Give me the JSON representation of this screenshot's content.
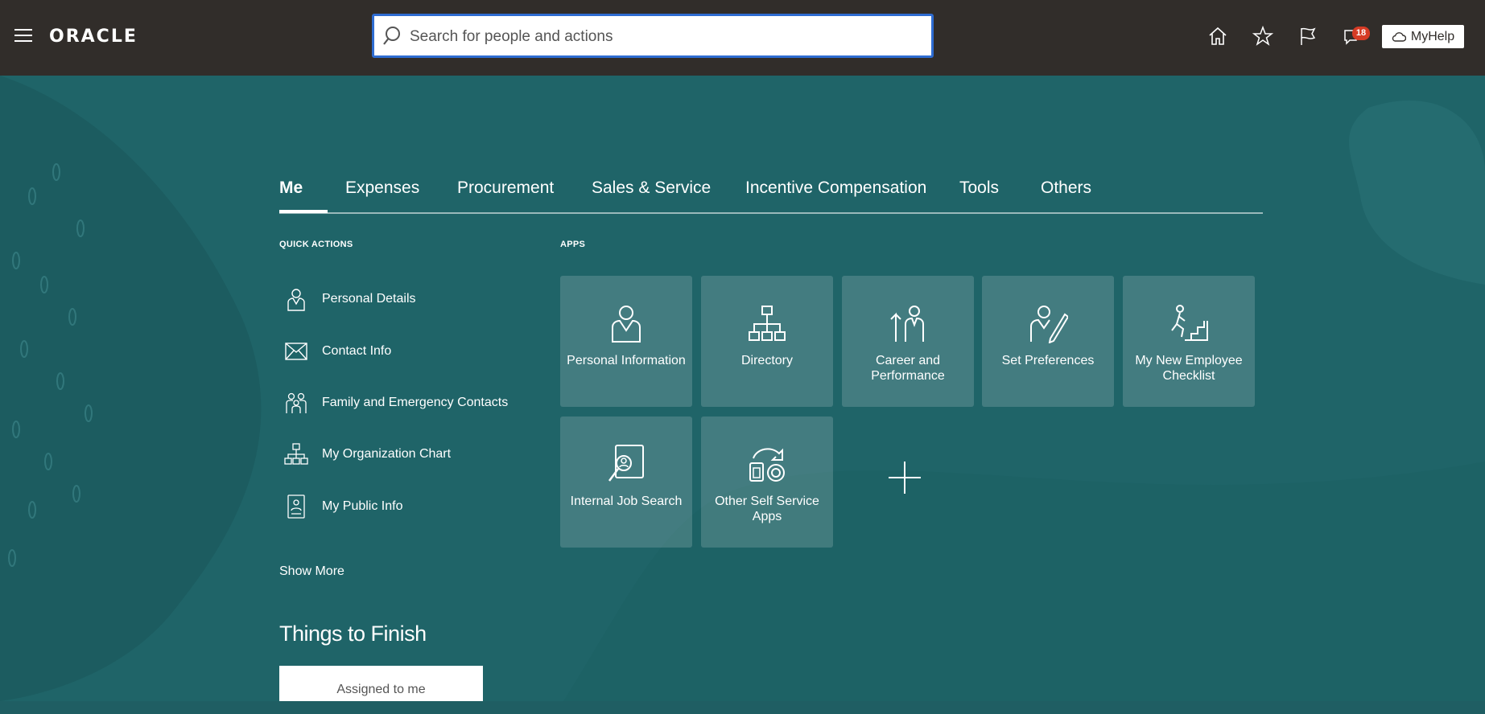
{
  "header": {
    "logo": "ORACLE",
    "search_placeholder": "Search for people and actions",
    "notification_count": "18",
    "myhelp_label": "MyHelp"
  },
  "tabs": [
    {
      "label": "Me",
      "active": true
    },
    {
      "label": "Expenses"
    },
    {
      "label": "Procurement"
    },
    {
      "label": "Sales & Service"
    },
    {
      "label": "Incentive Compensation"
    },
    {
      "label": "Tools"
    },
    {
      "label": "Others"
    }
  ],
  "quick_actions": {
    "heading": "QUICK ACTIONS",
    "items": [
      {
        "label": "Personal Details",
        "icon": "person-icon"
      },
      {
        "label": "Contact Info",
        "icon": "envelope-icon"
      },
      {
        "label": "Family and Emergency Contacts",
        "icon": "family-icon"
      },
      {
        "label": "My Organization Chart",
        "icon": "org-chart-icon"
      },
      {
        "label": "My Public Info",
        "icon": "id-badge-icon"
      }
    ],
    "show_more": "Show More"
  },
  "apps": {
    "heading": "APPS",
    "tiles": [
      {
        "label": "Personal Information",
        "icon": "person-icon"
      },
      {
        "label": "Directory",
        "icon": "org-chart-icon"
      },
      {
        "label": "Career and Performance",
        "icon": "career-icon"
      },
      {
        "label": "Set Preferences",
        "icon": "preferences-icon"
      },
      {
        "label": "My New Employee Checklist",
        "icon": "stairs-icon"
      },
      {
        "label": "Internal Job Search",
        "icon": "job-search-icon"
      },
      {
        "label": "Other Self Service Apps",
        "icon": "self-service-icon"
      }
    ]
  },
  "things_to_finish": {
    "title": "Things to Finish",
    "tab_label": "Assigned to me"
  },
  "colors": {
    "topbar": "#312d2a",
    "background": "#1f6468",
    "search_border": "#2e6cd1",
    "badge": "#d63b25"
  }
}
